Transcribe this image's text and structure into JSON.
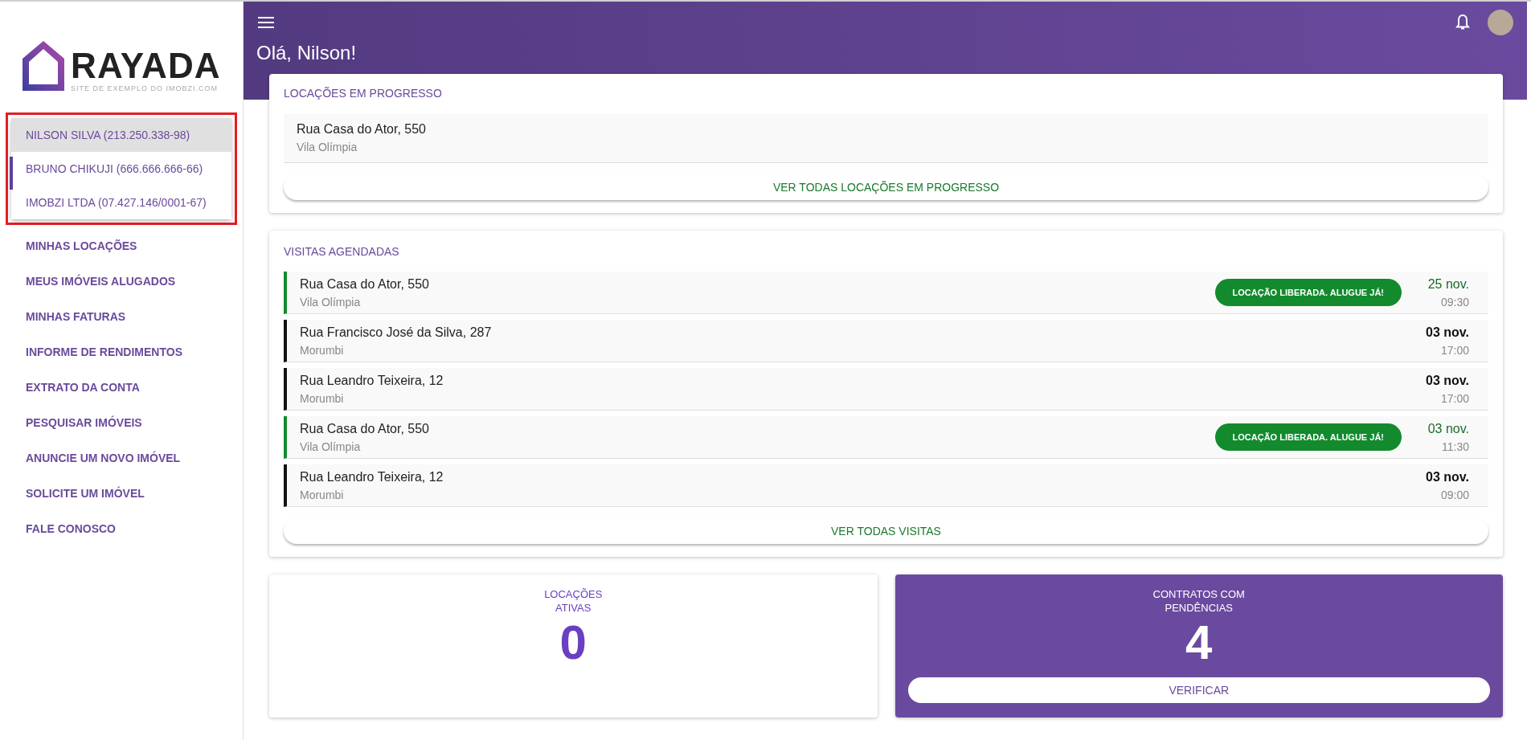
{
  "logo": {
    "name": "RAYADA",
    "tagline": "SITE DE EXEMPLO DO IMOBZI.COM"
  },
  "accounts": [
    {
      "label": "NILSON SILVA (213.250.338-98)",
      "selected": true
    },
    {
      "label": "BRUNO CHIKUJI (666.666.666-66)",
      "selected": false
    },
    {
      "label": "IMOBZI LTDA (07.427.146/0001-67)",
      "selected": false
    }
  ],
  "menu": [
    "MINHAS LOCAÇÕES",
    "MEUS IMÓVEIS ALUGADOS",
    "MINHAS FATURAS",
    "INFORME DE RENDIMENTOS",
    "EXTRATO DA CONTA",
    "PESQUISAR IMÓVEIS",
    "ANUNCIE UM NOVO IMÓVEL",
    "SOLICITE UM IMÓVEL",
    "FALE CONOSCO"
  ],
  "header": {
    "greeting": "Olá, Nilson!"
  },
  "rentals": {
    "title": "LOCAÇÕES EM PROGRESSO",
    "items": [
      {
        "street": "Rua Casa do Ator, 550",
        "district": "Vila Olímpia"
      }
    ],
    "button": "VER TODAS LOCAÇÕES EM PROGRESSO"
  },
  "visits": {
    "title": "VISITAS AGENDADAS",
    "items": [
      {
        "street": "Rua Casa do Ator, 550",
        "district": "Vila Olímpia",
        "released": true,
        "badge": "LOCAÇÃO LIBERADA. ALUGUE JÁ!",
        "date": "25 nov.",
        "time": "09:30"
      },
      {
        "street": "Rua Francisco José da Silva, 287",
        "district": "Morumbi",
        "released": false,
        "date": "03 nov.",
        "time": "17:00"
      },
      {
        "street": "Rua Leandro Teixeira, 12",
        "district": "Morumbi",
        "released": false,
        "date": "03 nov.",
        "time": "17:00"
      },
      {
        "street": "Rua Casa do Ator, 550",
        "district": "Vila Olímpia",
        "released": true,
        "badge": "LOCAÇÃO LIBERADA. ALUGUE JÁ!",
        "date": "03 nov.",
        "time": "11:30"
      },
      {
        "street": "Rua Leandro Teixeira, 12",
        "district": "Morumbi",
        "released": false,
        "date": "03 nov.",
        "time": "09:00"
      }
    ],
    "button": "VER TODAS VISITAS"
  },
  "stats": [
    {
      "kind": "plain",
      "label_lines": [
        "LOCAÇÕES",
        "ATIVAS"
      ],
      "value": "0"
    },
    {
      "kind": "highlight",
      "label_lines": [
        "CONTRATOS COM",
        "PENDÊNCIAS"
      ],
      "value": "4",
      "button": "VERIFICAR"
    }
  ]
}
